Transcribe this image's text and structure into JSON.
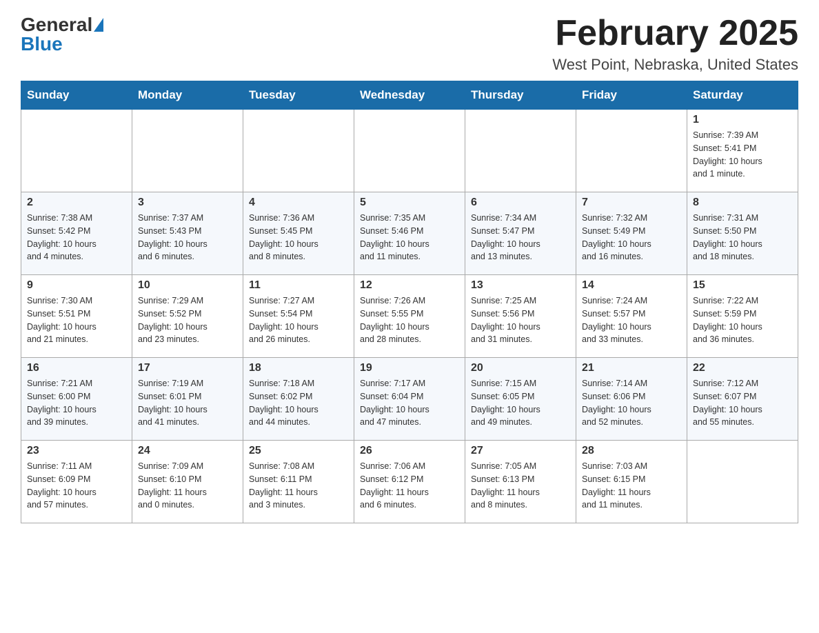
{
  "header": {
    "logo_general": "General",
    "logo_blue": "Blue",
    "title": "February 2025",
    "subtitle": "West Point, Nebraska, United States"
  },
  "days_of_week": [
    "Sunday",
    "Monday",
    "Tuesday",
    "Wednesday",
    "Thursday",
    "Friday",
    "Saturday"
  ],
  "weeks": [
    [
      {
        "day": "",
        "info": ""
      },
      {
        "day": "",
        "info": ""
      },
      {
        "day": "",
        "info": ""
      },
      {
        "day": "",
        "info": ""
      },
      {
        "day": "",
        "info": ""
      },
      {
        "day": "",
        "info": ""
      },
      {
        "day": "1",
        "info": "Sunrise: 7:39 AM\nSunset: 5:41 PM\nDaylight: 10 hours\nand 1 minute."
      }
    ],
    [
      {
        "day": "2",
        "info": "Sunrise: 7:38 AM\nSunset: 5:42 PM\nDaylight: 10 hours\nand 4 minutes."
      },
      {
        "day": "3",
        "info": "Sunrise: 7:37 AM\nSunset: 5:43 PM\nDaylight: 10 hours\nand 6 minutes."
      },
      {
        "day": "4",
        "info": "Sunrise: 7:36 AM\nSunset: 5:45 PM\nDaylight: 10 hours\nand 8 minutes."
      },
      {
        "day": "5",
        "info": "Sunrise: 7:35 AM\nSunset: 5:46 PM\nDaylight: 10 hours\nand 11 minutes."
      },
      {
        "day": "6",
        "info": "Sunrise: 7:34 AM\nSunset: 5:47 PM\nDaylight: 10 hours\nand 13 minutes."
      },
      {
        "day": "7",
        "info": "Sunrise: 7:32 AM\nSunset: 5:49 PM\nDaylight: 10 hours\nand 16 minutes."
      },
      {
        "day": "8",
        "info": "Sunrise: 7:31 AM\nSunset: 5:50 PM\nDaylight: 10 hours\nand 18 minutes."
      }
    ],
    [
      {
        "day": "9",
        "info": "Sunrise: 7:30 AM\nSunset: 5:51 PM\nDaylight: 10 hours\nand 21 minutes."
      },
      {
        "day": "10",
        "info": "Sunrise: 7:29 AM\nSunset: 5:52 PM\nDaylight: 10 hours\nand 23 minutes."
      },
      {
        "day": "11",
        "info": "Sunrise: 7:27 AM\nSunset: 5:54 PM\nDaylight: 10 hours\nand 26 minutes."
      },
      {
        "day": "12",
        "info": "Sunrise: 7:26 AM\nSunset: 5:55 PM\nDaylight: 10 hours\nand 28 minutes."
      },
      {
        "day": "13",
        "info": "Sunrise: 7:25 AM\nSunset: 5:56 PM\nDaylight: 10 hours\nand 31 minutes."
      },
      {
        "day": "14",
        "info": "Sunrise: 7:24 AM\nSunset: 5:57 PM\nDaylight: 10 hours\nand 33 minutes."
      },
      {
        "day": "15",
        "info": "Sunrise: 7:22 AM\nSunset: 5:59 PM\nDaylight: 10 hours\nand 36 minutes."
      }
    ],
    [
      {
        "day": "16",
        "info": "Sunrise: 7:21 AM\nSunset: 6:00 PM\nDaylight: 10 hours\nand 39 minutes."
      },
      {
        "day": "17",
        "info": "Sunrise: 7:19 AM\nSunset: 6:01 PM\nDaylight: 10 hours\nand 41 minutes."
      },
      {
        "day": "18",
        "info": "Sunrise: 7:18 AM\nSunset: 6:02 PM\nDaylight: 10 hours\nand 44 minutes."
      },
      {
        "day": "19",
        "info": "Sunrise: 7:17 AM\nSunset: 6:04 PM\nDaylight: 10 hours\nand 47 minutes."
      },
      {
        "day": "20",
        "info": "Sunrise: 7:15 AM\nSunset: 6:05 PM\nDaylight: 10 hours\nand 49 minutes."
      },
      {
        "day": "21",
        "info": "Sunrise: 7:14 AM\nSunset: 6:06 PM\nDaylight: 10 hours\nand 52 minutes."
      },
      {
        "day": "22",
        "info": "Sunrise: 7:12 AM\nSunset: 6:07 PM\nDaylight: 10 hours\nand 55 minutes."
      }
    ],
    [
      {
        "day": "23",
        "info": "Sunrise: 7:11 AM\nSunset: 6:09 PM\nDaylight: 10 hours\nand 57 minutes."
      },
      {
        "day": "24",
        "info": "Sunrise: 7:09 AM\nSunset: 6:10 PM\nDaylight: 11 hours\nand 0 minutes."
      },
      {
        "day": "25",
        "info": "Sunrise: 7:08 AM\nSunset: 6:11 PM\nDaylight: 11 hours\nand 3 minutes."
      },
      {
        "day": "26",
        "info": "Sunrise: 7:06 AM\nSunset: 6:12 PM\nDaylight: 11 hours\nand 6 minutes."
      },
      {
        "day": "27",
        "info": "Sunrise: 7:05 AM\nSunset: 6:13 PM\nDaylight: 11 hours\nand 8 minutes."
      },
      {
        "day": "28",
        "info": "Sunrise: 7:03 AM\nSunset: 6:15 PM\nDaylight: 11 hours\nand 11 minutes."
      },
      {
        "day": "",
        "info": ""
      }
    ]
  ]
}
